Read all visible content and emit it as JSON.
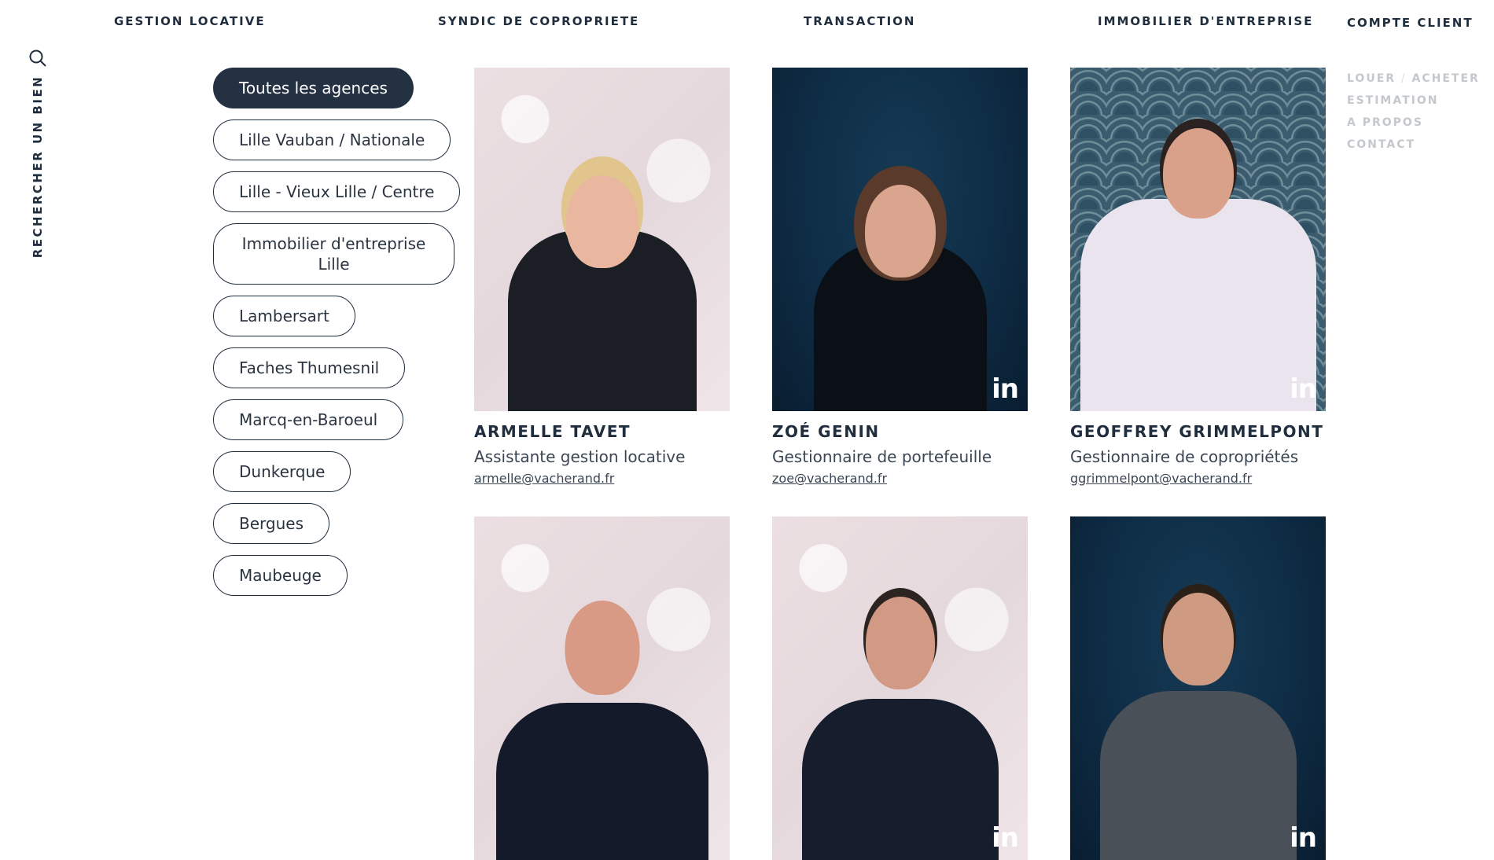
{
  "topnav": [
    {
      "label": "GESTION LOCATIVE"
    },
    {
      "label": "SYNDIC DE COPROPRIETE"
    },
    {
      "label": "TRANSACTION"
    },
    {
      "label": "IMMOBILIER D'ENTREPRISE"
    },
    {
      "label": "COMPTE CLIENT"
    }
  ],
  "side": {
    "search_label": "RECHERCHER UN BIEN",
    "search_icon": "search-icon"
  },
  "rightnav": {
    "louer": "LOUER",
    "separator": "/",
    "acheter": "ACHETER",
    "estimation": "ESTIMATION",
    "apropos": "A PROPOS",
    "contact": "CONTACT"
  },
  "agencies": [
    {
      "label": "Toutes les agences",
      "active": true
    },
    {
      "label": "Lille Vauban / Nationale"
    },
    {
      "label": "Lille - Vieux Lille / Centre"
    },
    {
      "label": "Immobilier d'entreprise Lille"
    },
    {
      "label": "Lambersart"
    },
    {
      "label": "Faches Thumesnil"
    },
    {
      "label": "Marcq-en-Baroeul"
    },
    {
      "label": "Dunkerque"
    },
    {
      "label": "Bergues"
    },
    {
      "label": "Maubeuge"
    }
  ],
  "team": [
    {
      "name": "ARMELLE TAVET",
      "role": "Assistante gestion locative",
      "email": "armelle@vacherand.fr",
      "linkedin": false
    },
    {
      "name": "ZOÉ GENIN",
      "role": "Gestionnaire de portefeuille",
      "email": "zoe@vacherand.fr",
      "linkedin": true
    },
    {
      "name": "GEOFFREY GRIMMELPONT",
      "role": "Gestionnaire de copropriétés",
      "email": "ggrimmelpont@vacherand.fr",
      "linkedin": true
    },
    {
      "name": "",
      "role": "",
      "email": "",
      "linkedin": false
    },
    {
      "name": "",
      "role": "",
      "email": "",
      "linkedin": true
    },
    {
      "name": "",
      "role": "",
      "email": "",
      "linkedin": true
    }
  ],
  "icons": {
    "linkedin": "in"
  },
  "colors": {
    "primary": "#243142",
    "muted_nav": "#c4c8cd"
  }
}
